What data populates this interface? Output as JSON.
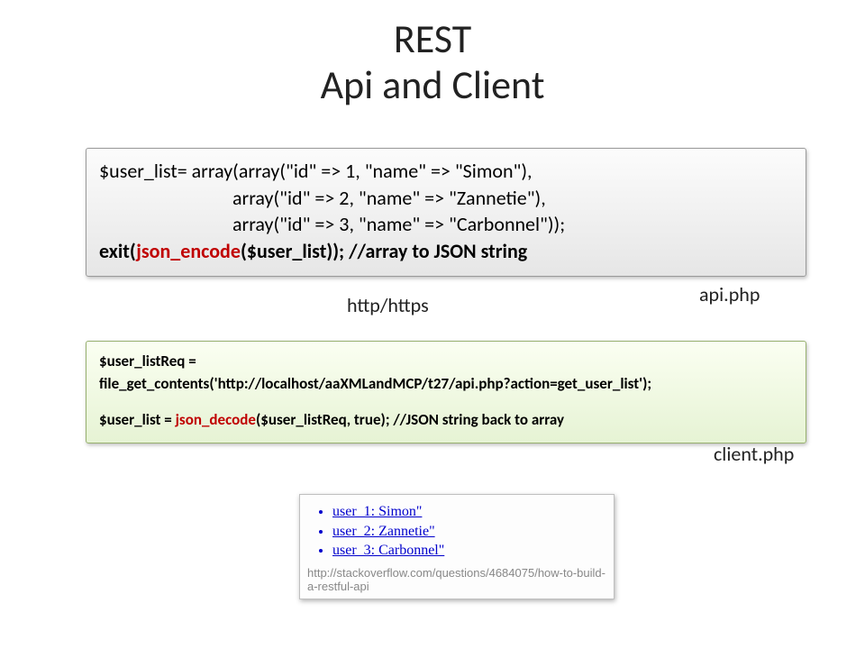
{
  "title_line1": "REST",
  "title_line2": "Api and Client",
  "box1": {
    "l1": "$user_list=  array(array(\"id\" => 1, \"name\" => \"Simon\"),",
    "l2": "array(\"id\" => 2, \"name\" => \"Zannetie\"),",
    "l3": "array(\"id\" => 3, \"name\" => \"Carbonnel\"));",
    "l4a": "exit(",
    "l4b": "json_encode",
    "l4c": "($user_list)); //array to JSON string"
  },
  "labels": {
    "http": "http/https",
    "api": "api.php",
    "client": "client.php"
  },
  "box2": {
    "l1": "$user_listReq =",
    "l2": "file_get_contents('http://localhost/aaXMLandMCP/t27/api.php?action=get_user_list');",
    "l3a": "$user_list = ",
    "l3b": "json_decode",
    "l3c": "($user_listReq, true); //JSON string back to array"
  },
  "result": {
    "items": [
      "user_1: Simon\"",
      "user_2: Zannetie\"",
      "user_3: Carbonnel\""
    ],
    "url": "http://stackoverflow.com/questions/4684075/how-to-build-a-restful-api"
  }
}
